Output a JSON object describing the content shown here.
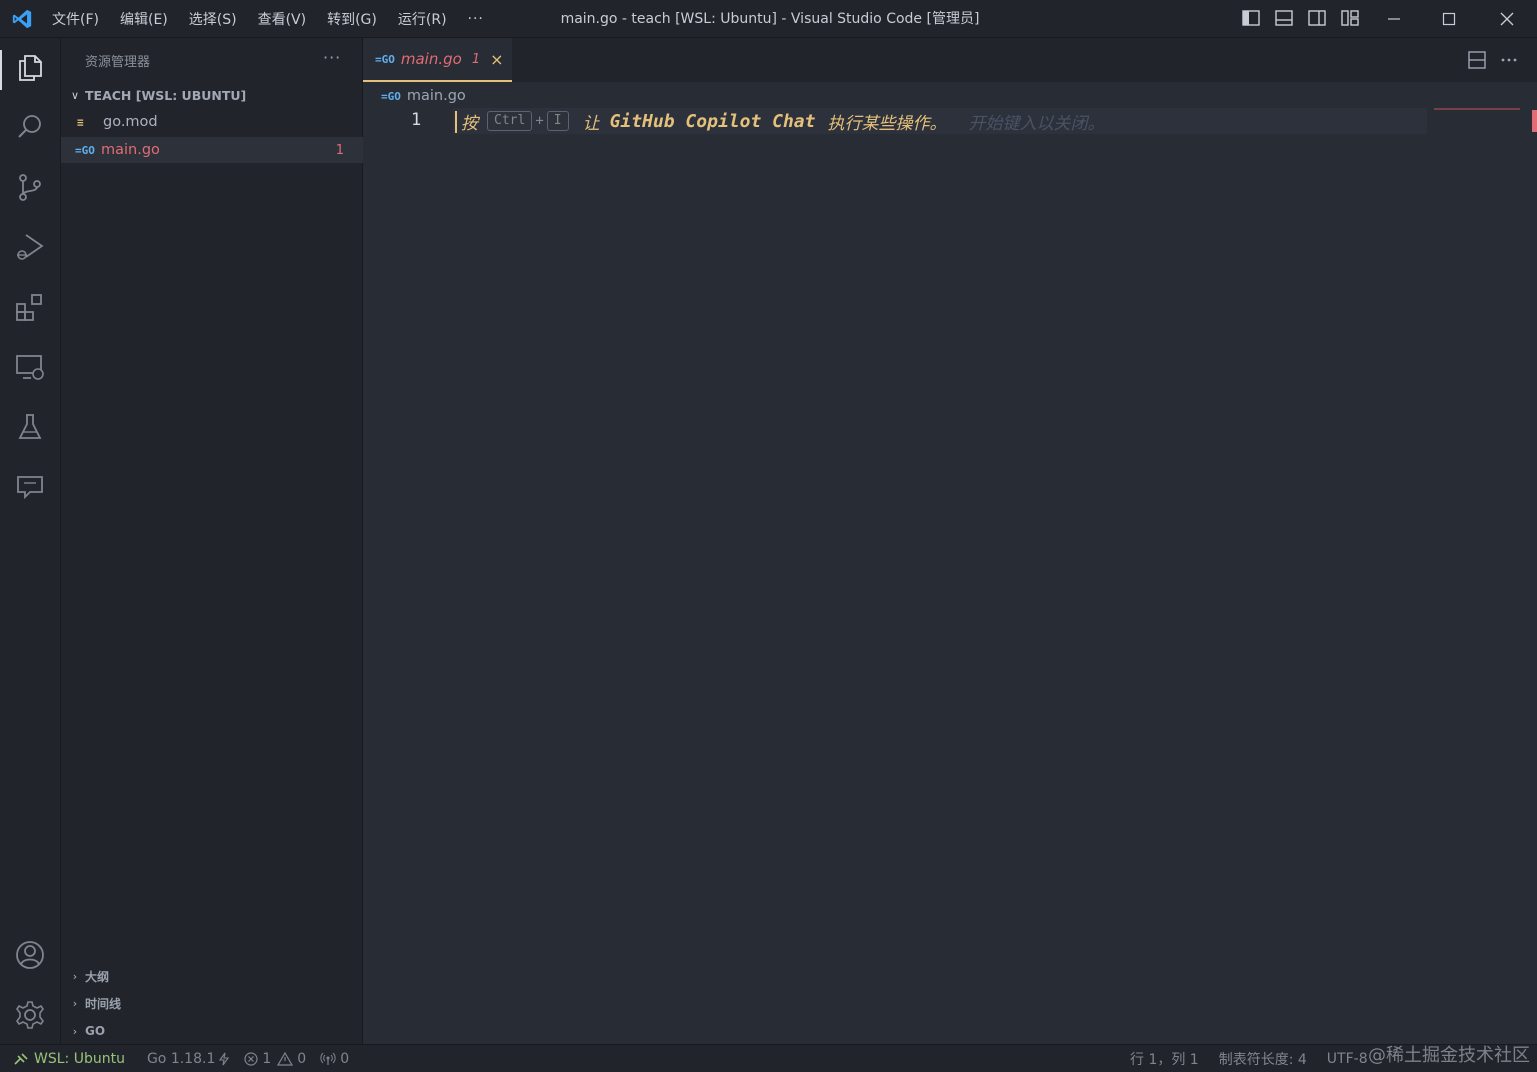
{
  "window": {
    "title": "main.go - teach [WSL: Ubuntu] - Visual Studio Code [管理员]",
    "menu": [
      "文件(F)",
      "编辑(E)",
      "选择(S)",
      "查看(V)",
      "转到(G)",
      "运行(R)"
    ],
    "menu_more": "···"
  },
  "activity_bar": {
    "items": [
      "explorer-icon",
      "search-icon",
      "source-control-icon",
      "run-debug-icon",
      "extensions-icon",
      "remote-explorer-icon",
      "testing-icon",
      "chat-icon"
    ],
    "bottom": [
      "account-icon",
      "settings-gear-icon"
    ]
  },
  "sidebar": {
    "title": "资源管理器",
    "more": "···",
    "folder": "TEACH [WSL: UBUNTU]",
    "files": [
      {
        "name": "go.mod",
        "icon": "≡",
        "badge": ""
      },
      {
        "name": "main.go",
        "icon": "=GO",
        "badge": "1"
      }
    ],
    "bottom_sections": [
      "大纲",
      "时间线",
      "GO"
    ]
  },
  "editor": {
    "tab": {
      "icon": "=GO",
      "name": "main.go",
      "badge": "1",
      "close": "×"
    },
    "breadcrumb": {
      "icon": "=GO",
      "name": "main.go"
    },
    "line_number": "1",
    "hint": {
      "press": "按",
      "key1": "Ctrl",
      "plus": "+",
      "key2": "I",
      "let": "让",
      "product": "GitHub Copilot Chat",
      "action": "执行某些操作。",
      "dismiss": "开始键入以关闭。"
    }
  },
  "status_bar": {
    "remote": "WSL: Ubuntu",
    "go_version": "Go 1.18.1",
    "errors": "1",
    "warnings": "0",
    "ports": "0",
    "position": "行 1，列 1",
    "tab_size": "制表符长度: 4",
    "encoding": "UTF-8",
    "watermark": "@稀土掘金技术社区"
  },
  "colors": {
    "accent_tab": "#e5c07b",
    "error": "#e06c75",
    "remote": "#98c379",
    "go_icon": "#61afef"
  }
}
